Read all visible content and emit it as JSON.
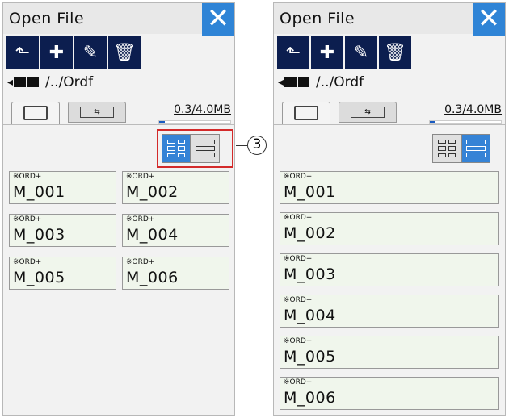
{
  "panels": [
    {
      "title": "Open File",
      "close_label": "✕",
      "path": "/../Ordf",
      "memory": "0.3/4.0MB",
      "memory_used_fraction": 0.075,
      "view_mode": "grid",
      "callout_number": "3",
      "files": [
        {
          "tag": "※ORD+",
          "name": "M_001"
        },
        {
          "tag": "※ORD+",
          "name": "M_002"
        },
        {
          "tag": "※ORD+",
          "name": "M_003"
        },
        {
          "tag": "※ORD+",
          "name": "M_004"
        },
        {
          "tag": "※ORD+",
          "name": "M_005"
        },
        {
          "tag": "※ORD+",
          "name": "M_006"
        }
      ]
    },
    {
      "title": "Open File",
      "close_label": "✕",
      "path": "/../Ordf",
      "memory": "0.3/4.0MB",
      "memory_used_fraction": 0.075,
      "view_mode": "list",
      "files": [
        {
          "tag": "※ORD+",
          "name": "M_001"
        },
        {
          "tag": "※ORD+",
          "name": "M_002"
        },
        {
          "tag": "※ORD+",
          "name": "M_003"
        },
        {
          "tag": "※ORD+",
          "name": "M_004"
        },
        {
          "tag": "※ORD+",
          "name": "M_005"
        },
        {
          "tag": "※ORD+",
          "name": "M_006"
        }
      ]
    }
  ],
  "toolbar_icons": [
    "back-arrow-icon",
    "new-folder-icon",
    "rename-pencil-icon",
    "delete-trash-icon"
  ],
  "colors": {
    "accent": "#2f84d6",
    "toolbar": "#0c1e4f",
    "file_bg": "#f0f6ec",
    "callout": "#d32a2a"
  }
}
